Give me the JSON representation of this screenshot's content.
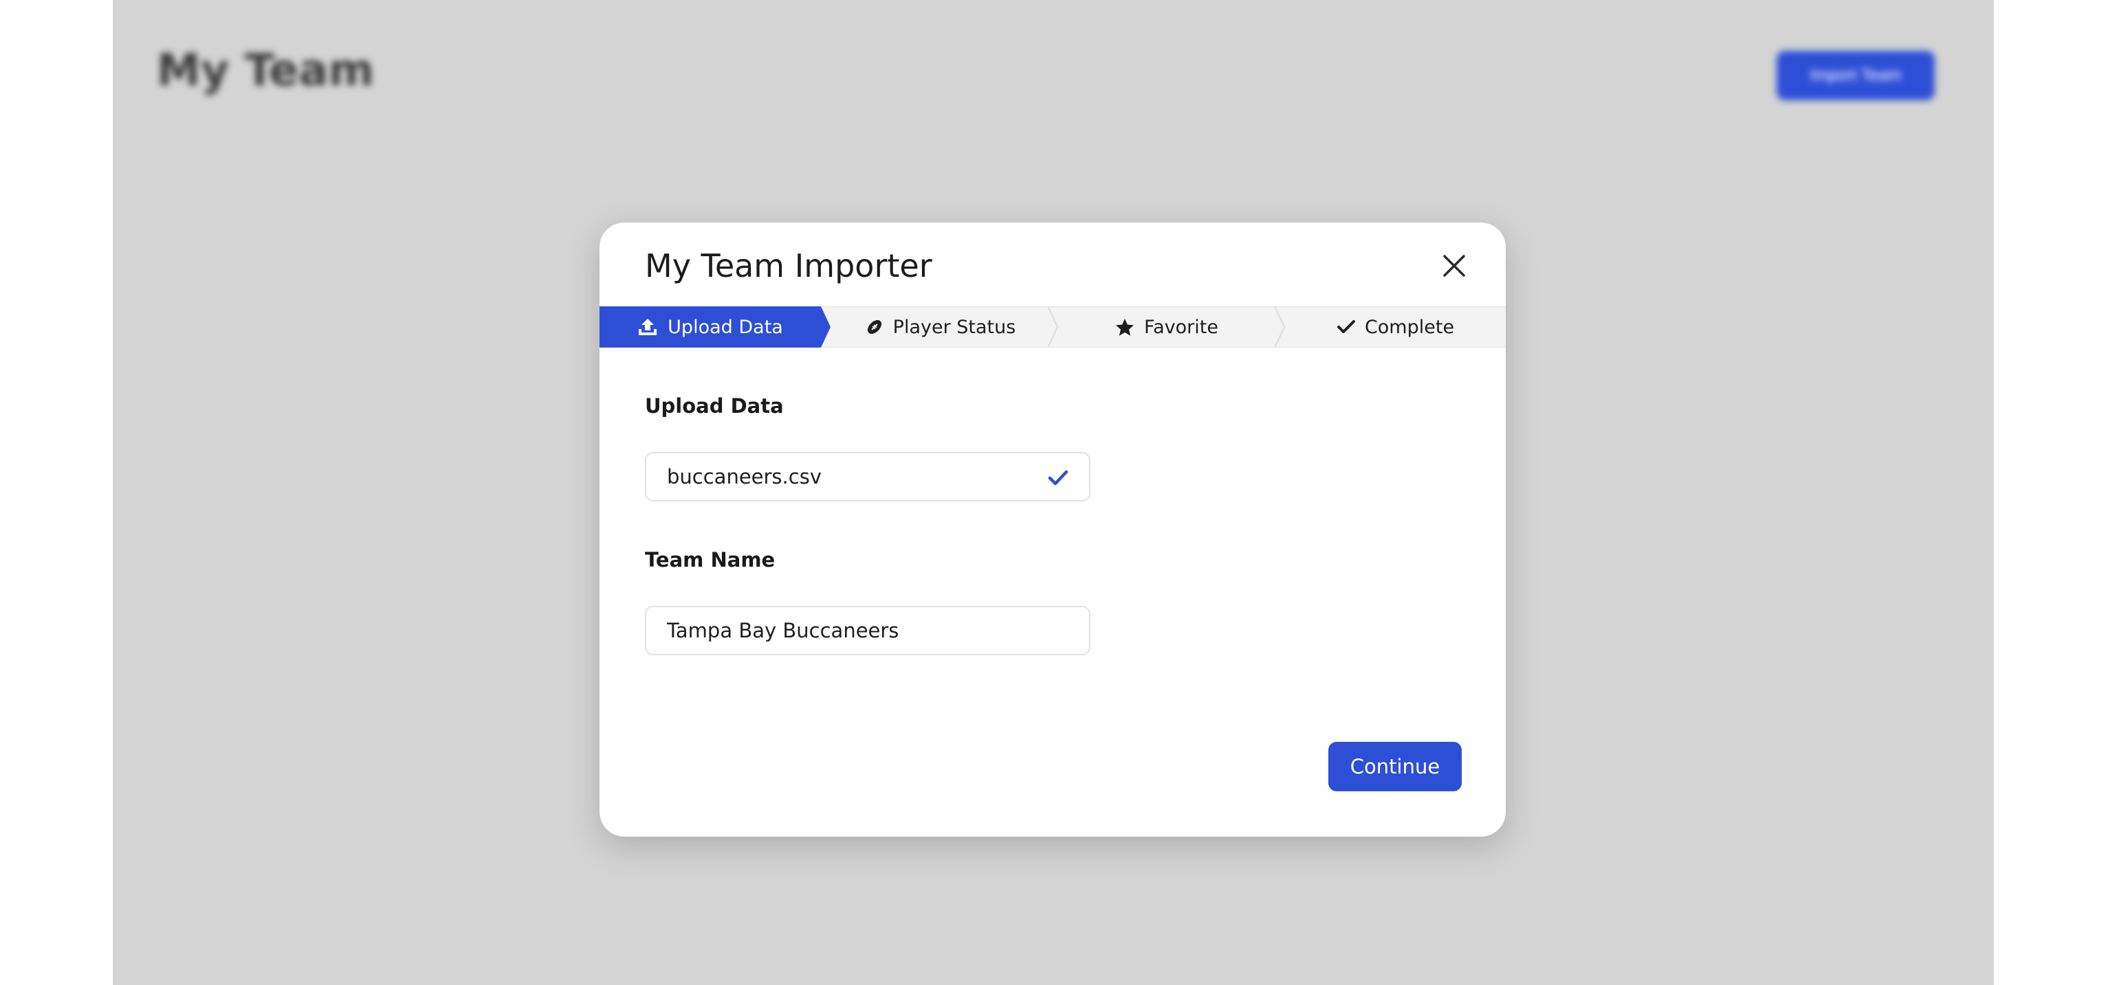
{
  "background": {
    "title": "My Team",
    "button_label": "Import Team"
  },
  "modal": {
    "title": "My Team Importer",
    "close_icon": "close-icon",
    "steps": [
      {
        "label": "Upload Data",
        "icon": "upload-icon",
        "active": true
      },
      {
        "label": "Player Status",
        "icon": "football-icon",
        "active": false
      },
      {
        "label": "Favorite",
        "icon": "star-icon",
        "active": false
      },
      {
        "label": "Complete",
        "icon": "check-icon",
        "active": false
      }
    ],
    "upload": {
      "label": "Upload Data",
      "file_name": "buccaneers.csv",
      "status_icon": "check-icon"
    },
    "team_name": {
      "label": "Team Name",
      "value": "Tampa Bay Buccaneers"
    },
    "continue_label": "Continue"
  },
  "colors": {
    "accent": "#2d4fd6",
    "overlay": "#d4d4d4",
    "step_inactive": "#f3f3f3"
  }
}
